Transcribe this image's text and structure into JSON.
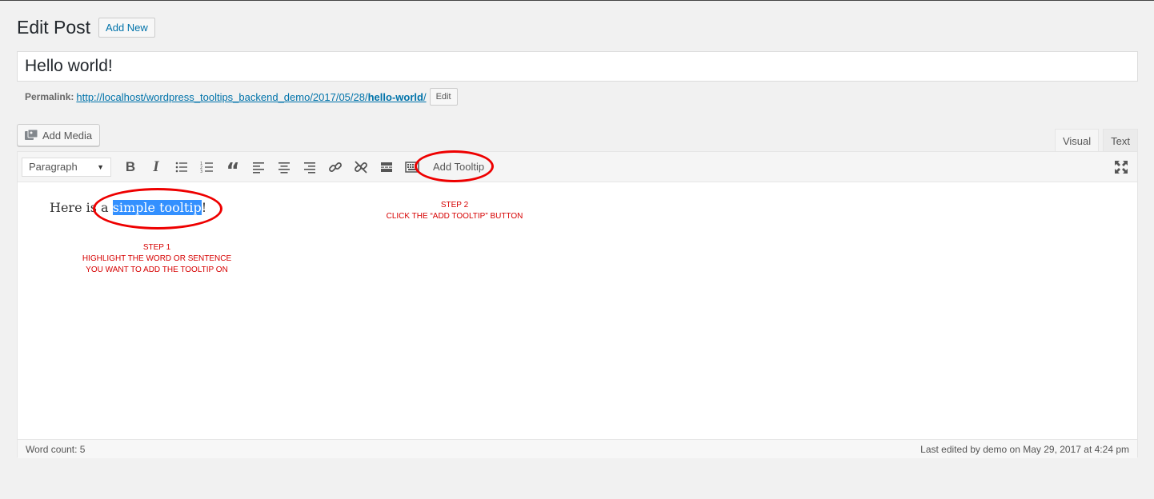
{
  "header": {
    "title": "Edit Post",
    "add_new_label": "Add New"
  },
  "post": {
    "title": "Hello world!"
  },
  "permalink": {
    "label": "Permalink:",
    "url_prefix": "http://localhost/wordpress_tooltips_backend_demo/2017/05/28/",
    "slug": "hello-world",
    "url_suffix": "/",
    "edit_label": "Edit"
  },
  "media": {
    "add_media_label": "Add Media"
  },
  "tabs": [
    {
      "label": "Visual",
      "active": true
    },
    {
      "label": "Text",
      "active": false
    }
  ],
  "toolbar": {
    "format_value": "Paragraph",
    "add_tooltip_label": "Add Tooltip",
    "icons": [
      "bold-icon",
      "italic-icon",
      "bullet-list-icon",
      "numbered-list-icon",
      "blockquote-icon",
      "align-left-icon",
      "align-center-icon",
      "align-right-icon",
      "link-icon",
      "unlink-icon",
      "read-more-icon",
      "toolbar-toggle-icon"
    ]
  },
  "content": {
    "before": "Here is a ",
    "highlighted": "simple tooltip",
    "after": "!"
  },
  "annotations": {
    "step1_title": "STEP 1",
    "step1_line1": "HIGHLIGHT THE WORD OR SENTENCE",
    "step1_line2": "YOU WANT TO ADD THE TOOLTIP ON",
    "step2_title": "STEP 2",
    "step2_line1": "CLICK THE “ADD TOOLTIP” BUTTON",
    "color": "#d60000"
  },
  "status": {
    "word_count": "Word count: 5",
    "last_edited": "Last edited by demo on May 29, 2017 at 4:24 pm"
  }
}
